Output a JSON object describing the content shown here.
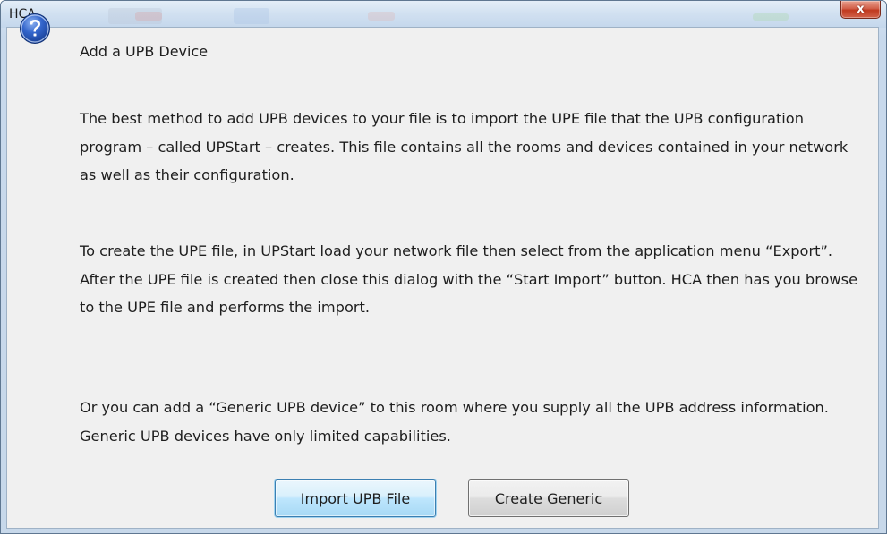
{
  "window": {
    "title": "HCA",
    "close_glyph": "x"
  },
  "dialog": {
    "icon": "question-icon",
    "header": "Add a UPB Device",
    "paragraphs": [
      "The best method to add UPB devices to your file is to import the UPE file that the UPB configuration program – called UPStart – creates. This file contains all the rooms and devices contained in your network as well as their configuration.",
      "To create the UPE file, in UPStart load your network file then select from the application menu “Export”. After the UPE file is created then close this dialog with the “Start Import” button. HCA then has you browse to the UPE file and performs the import.",
      "Or you can add a “Generic UPB device” to this room where you supply all the UPB address information. Generic UPB devices have only limited capabilities."
    ],
    "buttons": {
      "import_label": "Import UPB File",
      "generic_label": "Create Generic"
    }
  },
  "colors": {
    "icon_blue": "#2b57b8",
    "default_button_border": "#3c7fb1",
    "close_button": "#c9462c"
  }
}
